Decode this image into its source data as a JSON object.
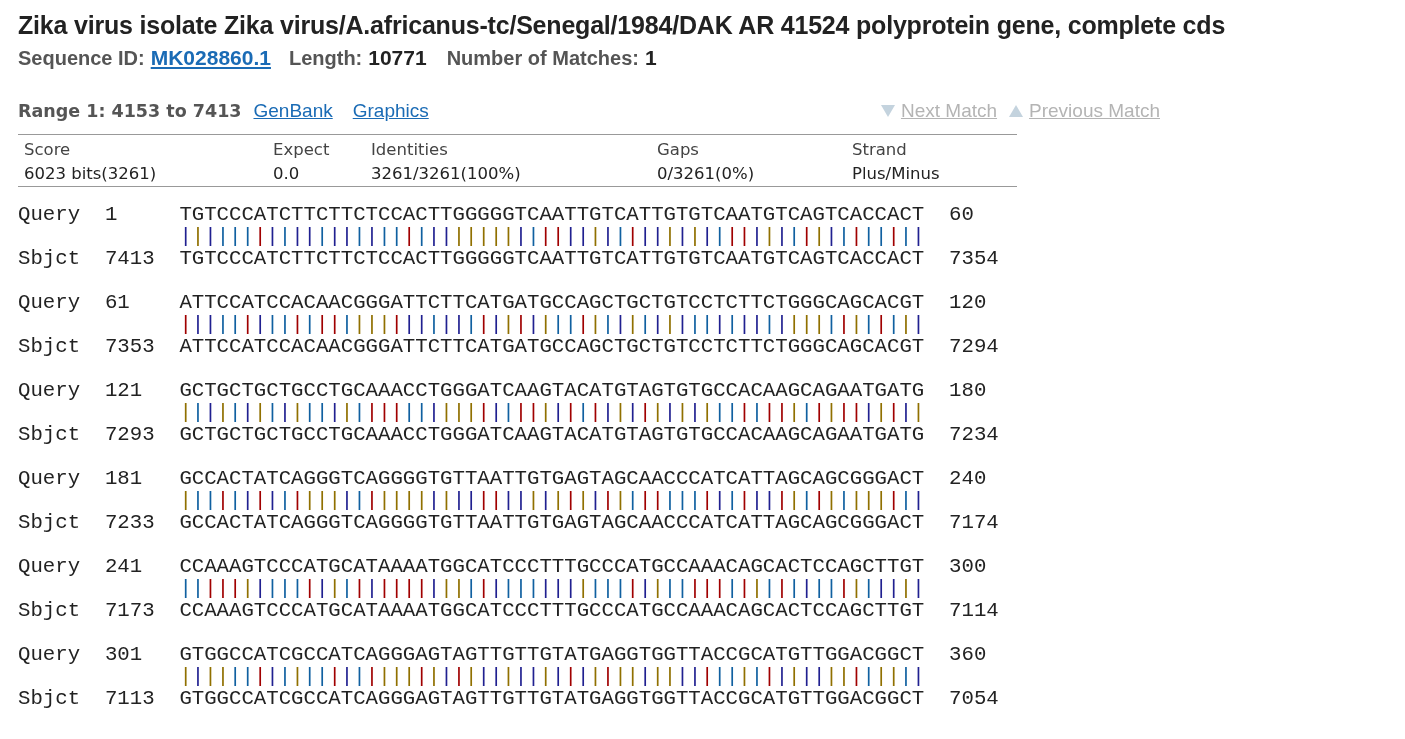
{
  "title": "Zika virus isolate Zika virus/A.africanus-tc/Senegal/1984/DAK AR 41524 polyprotein gene, complete cds",
  "sequence_info": {
    "id_label": "Sequence ID:",
    "id": "MK028860.1",
    "length_label": "Length:",
    "length": "10771",
    "matches_label": "Number of Matches:",
    "matches": "1"
  },
  "range": {
    "label": "Range 1: 4153 to 7413",
    "links": [
      "GenBank",
      "Graphics"
    ]
  },
  "navigation": [
    {
      "label": "Next Match",
      "kind": "next",
      "disabled": true
    },
    {
      "label": "Previous Match",
      "kind": "previous",
      "disabled": true
    }
  ],
  "scores": {
    "columns": [
      "Score",
      "Expect",
      "Identities",
      "Gaps",
      "Strand"
    ],
    "values": [
      "6023 bits(3261)",
      "0.0",
      "3261/3261(100%)",
      "0/3261(0%)",
      "Plus/Minus"
    ]
  },
  "alignment": [
    {
      "query_label": "Query",
      "query_start": "1",
      "query": "TGTCCCATCTTCTTCTCCACTTGGGGGTCAATTGTCATTGTGTCAATGTCAGTCACCACT",
      "query_end": "60",
      "match": "||||||||||||||||||||||||||||||||||||||||||||||||||||||||||||",
      "sbjct_label": "Sbjct",
      "sbjct_start": "7413",
      "sbjct": "TGTCCCATCTTCTTCTCCACTTGGGGGTCAATTGTCATTGTGTCAATGTCAGTCACCACT",
      "sbjct_end": "7354"
    },
    {
      "query_label": "Query",
      "query_start": "61",
      "query": "ATTCCATCCACAACGGGATTCTTCATGATGCCAGCTGCTGTCCTCTTCTGGGCAGCACGT",
      "query_end": "120",
      "match": "||||||||||||||||||||||||||||||||||||||||||||||||||||||||||||",
      "sbjct_label": "Sbjct",
      "sbjct_start": "7353",
      "sbjct": "ATTCCATCCACAACGGGATTCTTCATGATGCCAGCTGCTGTCCTCTTCTGGGCAGCACGT",
      "sbjct_end": "7294"
    },
    {
      "query_label": "Query",
      "query_start": "121",
      "query": "GCTGCTGCTGCCTGCAAACCTGGGATCAAGTACATGTAGTGTGCCACAAGCAGAATGATG",
      "query_end": "180",
      "match": "||||||||||||||||||||||||||||||||||||||||||||||||||||||||||||",
      "sbjct_label": "Sbjct",
      "sbjct_start": "7293",
      "sbjct": "GCTGCTGCTGCCTGCAAACCTGGGATCAAGTACATGTAGTGTGCCACAAGCAGAATGATG",
      "sbjct_end": "7234"
    },
    {
      "query_label": "Query",
      "query_start": "181",
      "query": "GCCACTATCAGGGTCAGGGGTGTTAATTGTGAGTAGCAACCCATCATTAGCAGCGGGACT",
      "query_end": "240",
      "match": "||||||||||||||||||||||||||||||||||||||||||||||||||||||||||||",
      "sbjct_label": "Sbjct",
      "sbjct_start": "7233",
      "sbjct": "GCCACTATCAGGGTCAGGGGTGTTAATTGTGAGTAGCAACCCATCATTAGCAGCGGGACT",
      "sbjct_end": "7174"
    },
    {
      "query_label": "Query",
      "query_start": "241",
      "query": "CCAAAGTCCCATGCATAAAATGGCATCCCTTTGCCCATGCCAAACAGCACTCCAGCTTGT",
      "query_end": "300",
      "match": "||||||||||||||||||||||||||||||||||||||||||||||||||||||||||||",
      "sbjct_label": "Sbjct",
      "sbjct_start": "7173",
      "sbjct": "CCAAAGTCCCATGCATAAAATGGCATCCCTTTGCCCATGCCAAACAGCACTCCAGCTTGT",
      "sbjct_end": "7114"
    },
    {
      "query_label": "Query",
      "query_start": "301",
      "query": "GTGGCCATCGCCATCAGGGAGTAGTTGTTGTATGAGGTGGTTACCGCATGTTGGACGGCT",
      "query_end": "360",
      "match": "||||||||||||||||||||||||||||||||||||||||||||||||||||||||||||",
      "sbjct_label": "Sbjct",
      "sbjct_start": "7113",
      "sbjct": "GTGGCCATCGCCATCAGGGAGTAGTTGTTGTATGAGGTGGTTACCGCATGTTGGACGGCT",
      "sbjct_end": "7054"
    }
  ]
}
